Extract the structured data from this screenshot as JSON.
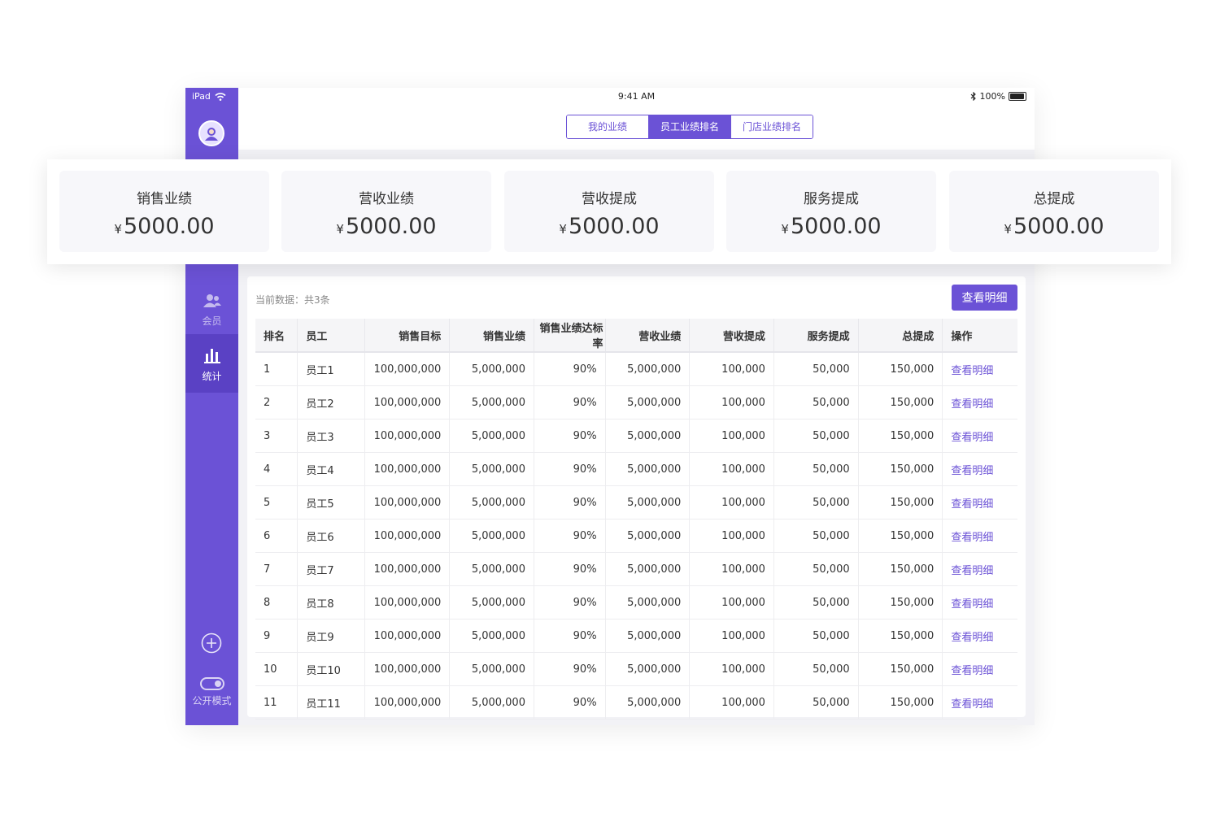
{
  "status_bar": {
    "device": "iPad",
    "time": "9:41 AM",
    "battery": "100%"
  },
  "tabs": [
    {
      "label": "我的业绩",
      "active": false
    },
    {
      "label": "员工业绩排名",
      "active": true
    },
    {
      "label": "门店业绩排名",
      "active": false
    }
  ],
  "sidebar": {
    "member_label": "会员",
    "stats_label": "统计",
    "public_mode_label": "公开模式"
  },
  "summary": {
    "currency": "¥",
    "cards": [
      {
        "title": "销售业绩",
        "value": "5000.00"
      },
      {
        "title": "营收业绩",
        "value": "5000.00"
      },
      {
        "title": "营收提成",
        "value": "5000.00"
      },
      {
        "title": "服务提成",
        "value": "5000.00"
      },
      {
        "title": "总提成",
        "value": "5000.00"
      }
    ]
  },
  "table": {
    "count_text": "当前数据：共3条",
    "detail_button": "查看明细",
    "columns": [
      "排名",
      "员工",
      "销售目标",
      "销售业绩",
      "销售业绩达标率",
      "营收业绩",
      "营收提成",
      "服务提成",
      "总提成",
      "操作"
    ],
    "rows": [
      [
        "1",
        "员工1",
        "100,000,000",
        "5,000,000",
        "90%",
        "5,000,000",
        "100,000",
        "50,000",
        "150,000",
        "查看明细"
      ],
      [
        "2",
        "员工2",
        "100,000,000",
        "5,000,000",
        "90%",
        "5,000,000",
        "100,000",
        "50,000",
        "150,000",
        "查看明细"
      ],
      [
        "3",
        "员工3",
        "100,000,000",
        "5,000,000",
        "90%",
        "5,000,000",
        "100,000",
        "50,000",
        "150,000",
        "查看明细"
      ],
      [
        "4",
        "员工4",
        "100,000,000",
        "5,000,000",
        "90%",
        "5,000,000",
        "100,000",
        "50,000",
        "150,000",
        "查看明细"
      ],
      [
        "5",
        "员工5",
        "100,000,000",
        "5,000,000",
        "90%",
        "5,000,000",
        "100,000",
        "50,000",
        "150,000",
        "查看明细"
      ],
      [
        "6",
        "员工6",
        "100,000,000",
        "5,000,000",
        "90%",
        "5,000,000",
        "100,000",
        "50,000",
        "150,000",
        "查看明细"
      ],
      [
        "7",
        "员工7",
        "100,000,000",
        "5,000,000",
        "90%",
        "5,000,000",
        "100,000",
        "50,000",
        "150,000",
        "查看明细"
      ],
      [
        "8",
        "员工8",
        "100,000,000",
        "5,000,000",
        "90%",
        "5,000,000",
        "100,000",
        "50,000",
        "150,000",
        "查看明细"
      ],
      [
        "9",
        "员工9",
        "100,000,000",
        "5,000,000",
        "90%",
        "5,000,000",
        "100,000",
        "50,000",
        "150,000",
        "查看明细"
      ],
      [
        "10",
        "员工10",
        "100,000,000",
        "5,000,000",
        "90%",
        "5,000,000",
        "100,000",
        "50,000",
        "150,000",
        "查看明细"
      ],
      [
        "11",
        "员工11",
        "100,000,000",
        "5,000,000",
        "90%",
        "5,000,000",
        "100,000",
        "50,000",
        "150,000",
        "查看明细"
      ]
    ]
  },
  "colors": {
    "accent": "#6b52d6",
    "accent_dark": "#5a41c4"
  }
}
